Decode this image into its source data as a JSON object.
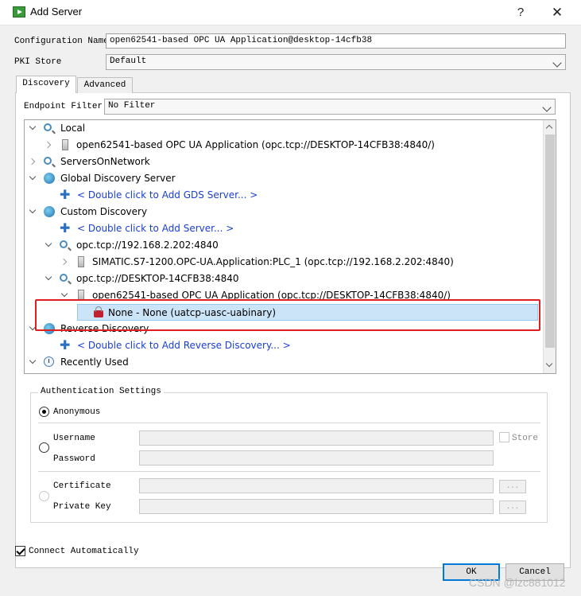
{
  "window": {
    "title": "Add Server",
    "help_glyph": "?",
    "close_glyph": "✕"
  },
  "form": {
    "config_name_label": "Configuration Name",
    "config_name_value": "open62541-based OPC UA Application@desktop-14cfb38",
    "pki_store_label": "PKI Store",
    "pki_store_value": "Default"
  },
  "tabs": [
    {
      "label": "Discovery",
      "active": true
    },
    {
      "label": "Advanced",
      "active": false
    }
  ],
  "discovery": {
    "endpoint_filter_label": "Endpoint Filter:",
    "endpoint_filter_value": "No Filter",
    "tree": [
      {
        "label": "Local",
        "icon": "search-icon",
        "expander": "open"
      },
      {
        "label": "open62541-based OPC UA Application (opc.tcp://DESKTOP-14CFB38:4840/)",
        "icon": "server-icon",
        "expander": "closed"
      },
      {
        "label": "ServersOnNetwork",
        "icon": "search-icon",
        "expander": "closed"
      },
      {
        "label": "Global Discovery Server",
        "icon": "globe-icon",
        "expander": "open"
      },
      {
        "label": "< Double click to Add GDS Server... >",
        "icon": "plus-icon",
        "link": true
      },
      {
        "label": "Custom Discovery",
        "icon": "globe-icon",
        "expander": "open"
      },
      {
        "label": "< Double click to Add Server... >",
        "icon": "plus-icon",
        "link": true
      },
      {
        "label": "opc.tcp://192.168.2.202:4840",
        "icon": "search-icon",
        "expander": "open"
      },
      {
        "label": "SIMATIC.S7-1200.OPC-UA.Application:PLC_1 (opc.tcp://192.168.2.202:4840)",
        "icon": "server-icon",
        "expander": "closed"
      },
      {
        "label": "opc.tcp://DESKTOP-14CFB38:4840",
        "icon": "search-icon",
        "expander": "open"
      },
      {
        "label": "open62541-based OPC UA Application (opc.tcp://DESKTOP-14CFB38:4840/)",
        "icon": "server-icon",
        "expander": "open"
      },
      {
        "label": "None - None (uatcp-uasc-uabinary)",
        "icon": "lock-icon",
        "selected": true
      },
      {
        "label": "Reverse Discovery",
        "icon": "globe-icon",
        "expander": "open"
      },
      {
        "label": "< Double click to Add Reverse Discovery... >",
        "icon": "plus-icon",
        "link": true
      },
      {
        "label": "Recently Used",
        "icon": "clock-icon",
        "expander": "open"
      }
    ]
  },
  "auth": {
    "title": "Authentication Settings",
    "anonymous_label": "Anonymous",
    "username_label": "Username",
    "password_label": "Password",
    "store_label": "Store",
    "certificate_label": "Certificate",
    "private_key_label": "Private Key",
    "browse_label": "..."
  },
  "footer": {
    "connect_auto_label": "Connect Automatically",
    "ok_label": "OK",
    "cancel_label": "Cancel"
  },
  "watermark": "CSDN @lzc881012",
  "colors": {
    "link": "#1a3fd0",
    "selection": "#cce4f7",
    "highlight_box": "#e02020",
    "primary_border": "#0078d7"
  }
}
